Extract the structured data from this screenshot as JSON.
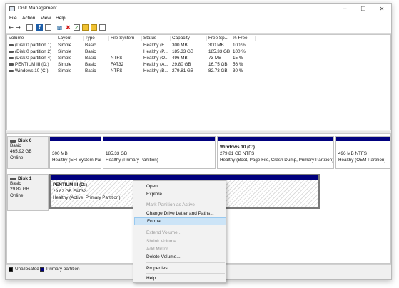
{
  "window": {
    "title": "Disk Management",
    "controls": {
      "minimize": "─",
      "maximize": "☐",
      "close": "✕"
    }
  },
  "menu": [
    "File",
    "Action",
    "View",
    "Help"
  ],
  "toolbar": {
    "icons": [
      "back-arrow-icon",
      "forward-arrow-icon",
      "console-tree-icon",
      "help-icon",
      "properties-icon",
      "connect-icon",
      "delete-icon",
      "check-icon",
      "folder-icon",
      "search-folder-icon",
      "list-view-icon"
    ]
  },
  "volume_list": {
    "columns": [
      "Volume",
      "Layout",
      "Type",
      "File System",
      "Status",
      "Capacity",
      "Free Sp...",
      "% Free"
    ],
    "rows": [
      [
        "(Disk 0 partition 1)",
        "Simple",
        "Basic",
        "",
        "Healthy (E...",
        "300 MB",
        "300 MB",
        "100 %"
      ],
      [
        "(Disk 0 partition 2)",
        "Simple",
        "Basic",
        "",
        "Healthy (P...",
        "185.33 GB",
        "185.33 GB",
        "100 %"
      ],
      [
        "(Disk 0 partition 4)",
        "Simple",
        "Basic",
        "NTFS",
        "Healthy (O...",
        "496 MB",
        "73 MB",
        "15 %"
      ],
      [
        "PENTIUM III (D:)",
        "Simple",
        "Basic",
        "FAT32",
        "Healthy (A...",
        "29.80 GB",
        "16.75 GB",
        "56 %"
      ],
      [
        "Windows 10 (C:)",
        "Simple",
        "Basic",
        "NTFS",
        "Healthy (B...",
        "279.81 GB",
        "82.73 GB",
        "30 %"
      ]
    ]
  },
  "disks": [
    {
      "name": "Disk 0",
      "type": "Basic",
      "size": "465.92 GB",
      "status": "Online",
      "partitions": [
        {
          "title": "",
          "line1": "300 MB",
          "line2": "Healthy (EFI System Par"
        },
        {
          "title": "",
          "line1": "185.33 GB",
          "line2": "Healthy (Primary Partition)"
        },
        {
          "title": "Windows 10  (C:)",
          "line1": "279.81 GB NTFS",
          "line2": "Healthy (Boot, Page File, Crash Dump, Primary Partition)"
        },
        {
          "title": "",
          "line1": "496 MB NTFS",
          "line2": "Healthy (OEM Partition)"
        }
      ]
    },
    {
      "name": "Disk 1",
      "type": "Basic",
      "size": "29.82 GB",
      "status": "Online",
      "partitions": [
        {
          "title": "PENTIUM III  (D:)",
          "line1": "29.82 GB FAT32",
          "line2": "Healthy (Active, Primary Partition)"
        }
      ]
    }
  ],
  "legend": [
    {
      "label": "Unallocated",
      "color": "#000000"
    },
    {
      "label": "Primary partition",
      "color": "#00007e"
    }
  ],
  "context_menu": {
    "items": [
      {
        "label": "Open",
        "enabled": true
      },
      {
        "label": "Explore",
        "enabled": true
      },
      {
        "label": "Mark Partition as Active",
        "enabled": false
      },
      {
        "label": "Change Drive Letter and Paths...",
        "enabled": true
      },
      {
        "label": "Format...",
        "enabled": true,
        "highlighted": true
      },
      {
        "label": "Extend Volume...",
        "enabled": false
      },
      {
        "label": "Shrink Volume...",
        "enabled": false
      },
      {
        "label": "Add Mirror...",
        "enabled": false
      },
      {
        "label": "Delete Volume...",
        "enabled": true
      },
      {
        "label": "Properties",
        "enabled": true
      },
      {
        "label": "Help",
        "enabled": true
      }
    ]
  }
}
